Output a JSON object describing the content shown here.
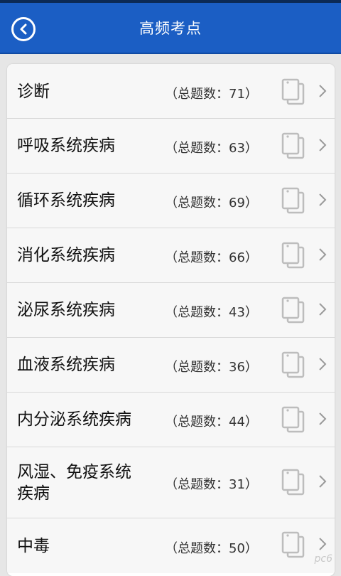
{
  "header": {
    "title": "高频考点",
    "back_icon": "back-arrow-circle-icon",
    "color": "#1b5ec4"
  },
  "items": [
    {
      "name": "诊断",
      "count": "（总题数：71）"
    },
    {
      "name": "呼吸系统疾病",
      "count": "（总题数：63）"
    },
    {
      "name": "循环系统疾病",
      "count": "（总题数：69）"
    },
    {
      "name": "消化系统疾病",
      "count": "（总题数：66）"
    },
    {
      "name": "泌尿系统疾病",
      "count": "（总题数：43）"
    },
    {
      "name": "血液系统疾病",
      "count": "（总题数：36）"
    },
    {
      "name": "内分泌系统疾病",
      "count": "（总题数：44）"
    },
    {
      "name": "风湿、免疫系统\n疾病",
      "count": "（总题数：31）"
    },
    {
      "name": "中毒",
      "count": "（总题数：50）"
    }
  ],
  "icons": {
    "doc": "document-copy-icon",
    "chevron": "chevron-right-icon"
  },
  "watermark": "pc6"
}
